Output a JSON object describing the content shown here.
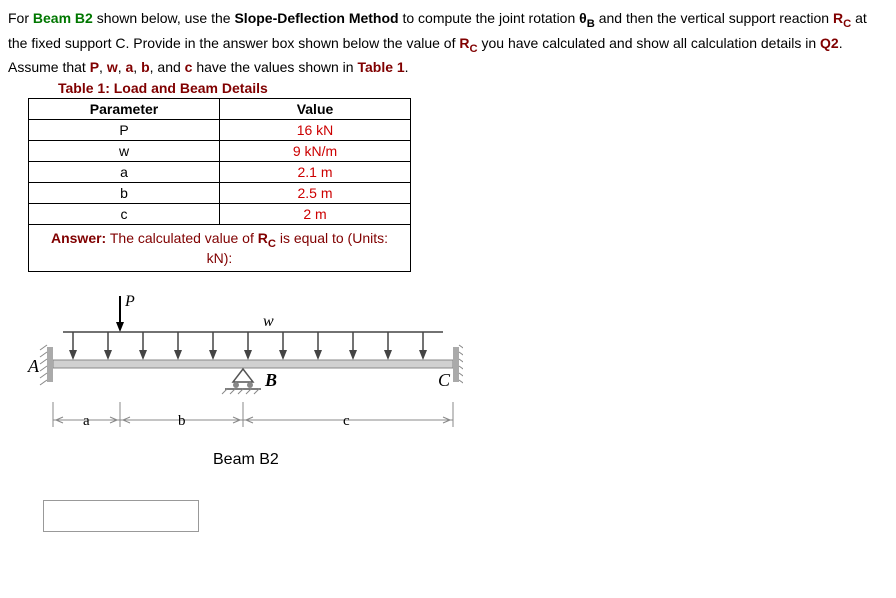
{
  "problem": {
    "prefix": "For ",
    "beam_name": "Beam B2",
    "text1": " shown below, use the ",
    "method": "Slope-Deflection Method",
    "text2": " to compute the joint rotation ",
    "thetaB": "θ",
    "thetaB_sub": "B",
    "text3": " and then the vertical support reaction ",
    "RC": "R",
    "RC_sub": "C",
    "text4": " at the fixed support C.  Provide in the answer box shown below the value of ",
    "text5": " you have calculated and show all calculation details in ",
    "Q2": "Q2",
    "text6": ".  Assume that ",
    "P": "P",
    "comma1": ", ",
    "w": "w",
    "comma2": ", ",
    "a": "a",
    "comma3": ", ",
    "b": "b",
    "comma4": ", and ",
    "c": "c",
    "text7": " have the values shown in ",
    "table_ref": "Table 1",
    "period": "."
  },
  "table_title": "Table 1: Load and Beam Details",
  "table": {
    "header_param": "Parameter",
    "header_value": "Value",
    "rows": [
      {
        "param": "P",
        "value": "16 kN"
      },
      {
        "param": "w",
        "value": "9 kN/m"
      },
      {
        "param": "a",
        "value": "2.1 m"
      },
      {
        "param": "b",
        "value": "2.5 m"
      },
      {
        "param": "c",
        "value": "2 m"
      }
    ]
  },
  "answer": {
    "prefix": "Answer:",
    "text1": " The calculated value of ",
    "RC": "R",
    "RC_sub": "C",
    "text2": " is equal to (Units: kN):"
  },
  "diagram": {
    "P": "P",
    "w": "w",
    "A": "A",
    "B": "B",
    "C": "C",
    "a": "a",
    "b": "b",
    "c": "c",
    "caption": "Beam B2"
  }
}
